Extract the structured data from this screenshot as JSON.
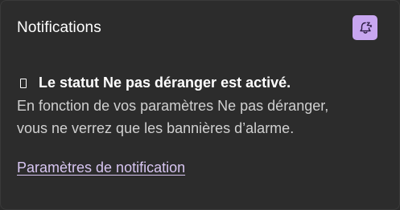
{
  "header": {
    "title": "Notifications",
    "dnd_toggle_icon": "bell-snooze-icon",
    "accent_color": "#c8a6f0"
  },
  "status": {
    "glyph_icon": "placeholder-glyph-icon",
    "title": "Le statut Ne pas déranger est activé.",
    "description_line1": "En fonction de vos paramètres Ne pas déranger,",
    "description_line2": "vous ne verrez que les bannières d’alarme."
  },
  "links": {
    "settings_label": "Paramètres de notification",
    "link_color": "#d8c6f2"
  }
}
